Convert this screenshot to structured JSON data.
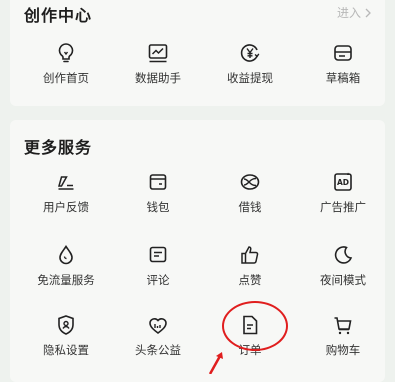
{
  "creator_center": {
    "title": "创作中心",
    "enter_label": "进入",
    "items": [
      {
        "label": "创作首页",
        "icon": "lightbulb-icon"
      },
      {
        "label": "数据助手",
        "icon": "chart-icon"
      },
      {
        "label": "收益提现",
        "icon": "yuan-icon"
      },
      {
        "label": "草稿箱",
        "icon": "drafts-icon"
      }
    ]
  },
  "more_services": {
    "title": "更多服务",
    "items": [
      {
        "label": "用户反馈",
        "icon": "feedback-pen-icon"
      },
      {
        "label": "钱包",
        "icon": "wallet-icon"
      },
      {
        "label": "借钱",
        "icon": "borrow-icon"
      },
      {
        "label": "广告推广",
        "icon": "ad-icon"
      },
      {
        "label": "免流量服务",
        "icon": "drop-icon"
      },
      {
        "label": "评论",
        "icon": "comment-icon"
      },
      {
        "label": "点赞",
        "icon": "thumbs-up-icon"
      },
      {
        "label": "夜间模式",
        "icon": "moon-icon"
      },
      {
        "label": "隐私设置",
        "icon": "shield-icon"
      },
      {
        "label": "头条公益",
        "icon": "charity-icon"
      },
      {
        "label": "订单",
        "icon": "order-icon"
      },
      {
        "label": "购物车",
        "icon": "cart-icon"
      }
    ]
  },
  "colors": {
    "background": "#eef2ee",
    "card": "#f7f8f6",
    "highlight": "#e01e1e"
  }
}
